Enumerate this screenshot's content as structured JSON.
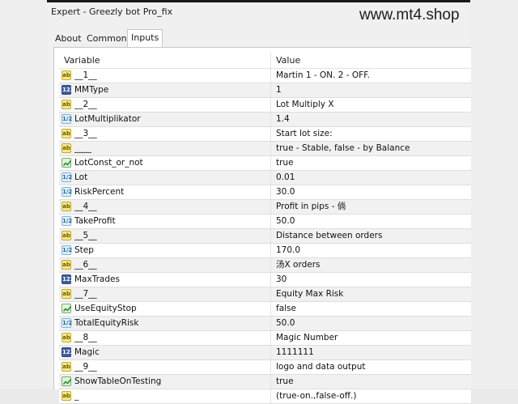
{
  "window": {
    "title": "Expert - Greezly bot Pro_fix"
  },
  "watermark": "www.mt4.shop",
  "tabs": [
    {
      "label": "About"
    },
    {
      "label": "Common"
    },
    {
      "label": "Inputs",
      "active": true
    }
  ],
  "grid": {
    "headers": {
      "variable": "Variable",
      "value": "Value"
    },
    "rows": [
      {
        "type": "string",
        "icon_text": "ab",
        "name": "__1__",
        "value": "Martin 1 - ON. 2 - OFF."
      },
      {
        "type": "int",
        "icon_text": "123",
        "name": "MMType",
        "value": "1"
      },
      {
        "type": "string",
        "icon_text": "ab",
        "name": "__2__",
        "value": "Lot Multiply X"
      },
      {
        "type": "double",
        "icon_text": "1/2",
        "name": "LotMultiplikator",
        "value": "1.4"
      },
      {
        "type": "string",
        "icon_text": "ab",
        "name": "__3__",
        "value": "Start lot size:"
      },
      {
        "type": "string",
        "icon_text": "ab",
        "name": "____",
        "value": "true - Stable, false - by Balance"
      },
      {
        "type": "bool",
        "icon_text": "",
        "name": "LotConst_or_not",
        "value": "true"
      },
      {
        "type": "double",
        "icon_text": "1/2",
        "name": "Lot",
        "value": "0.01"
      },
      {
        "type": "double",
        "icon_text": "1/2",
        "name": "RiskPercent",
        "value": "30.0"
      },
      {
        "type": "string",
        "icon_text": "ab",
        "name": "__4__",
        "value": "Profit in pips - 倘"
      },
      {
        "type": "double",
        "icon_text": "1/2",
        "name": "TakeProfit",
        "value": "50.0"
      },
      {
        "type": "string",
        "icon_text": "ab",
        "name": "__5__",
        "value": "Distance between orders"
      },
      {
        "type": "double",
        "icon_text": "1/2",
        "name": "Step",
        "value": "170.0"
      },
      {
        "type": "string",
        "icon_text": "ab",
        "name": "__6__",
        "value": "汤X orders"
      },
      {
        "type": "int",
        "icon_text": "123",
        "name": "MaxTrades",
        "value": "30"
      },
      {
        "type": "string",
        "icon_text": "ab",
        "name": "__7__",
        "value": "Equity Max Risk"
      },
      {
        "type": "bool",
        "icon_text": "",
        "name": "UseEquityStop",
        "value": "false"
      },
      {
        "type": "double",
        "icon_text": "1/2",
        "name": "TotalEquityRisk",
        "value": "50.0"
      },
      {
        "type": "string",
        "icon_text": "ab",
        "name": "__8__",
        "value": "Magic Number"
      },
      {
        "type": "int",
        "icon_text": "123",
        "name": "Magic",
        "value": "1111111"
      },
      {
        "type": "string",
        "icon_text": "ab",
        "name": "__9__",
        "value": "logo and data output"
      },
      {
        "type": "bool",
        "icon_text": "",
        "name": "ShowTableOnTesting",
        "value": "true"
      },
      {
        "type": "string",
        "icon_text": "ab",
        "name": "_",
        "value": "(true-on.,false-off.)"
      }
    ]
  }
}
